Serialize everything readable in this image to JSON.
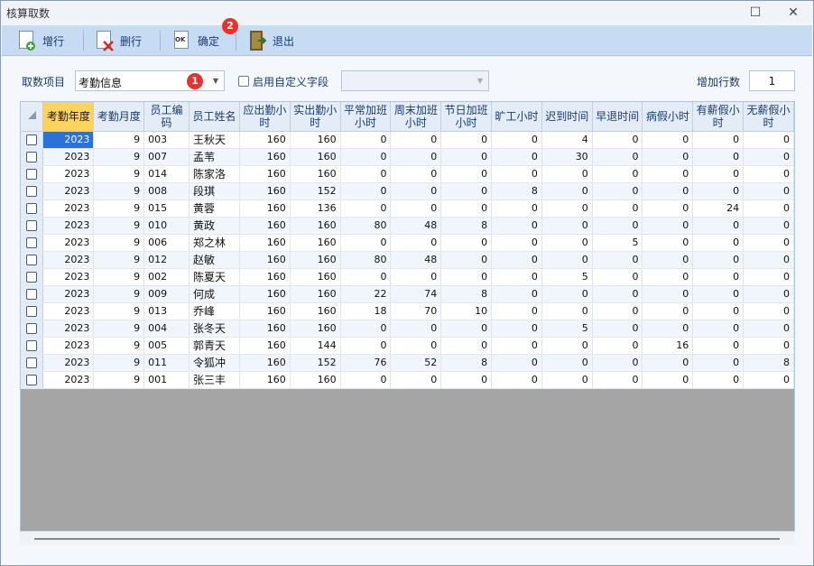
{
  "window": {
    "title": "核算取数",
    "minimize_glyph": "─",
    "maximize_glyph": "☐",
    "close_glyph": "✕"
  },
  "toolbar": {
    "add_row": "增行",
    "delete_row": "删行",
    "confirm": "确定",
    "exit": "退出",
    "ok_icon_text": "OK"
  },
  "badges": {
    "one": "1",
    "two": "2"
  },
  "filters": {
    "fetch_item_label": "取数项目",
    "fetch_item_value": "考勤信息",
    "custom_field_label": "启用自定义字段",
    "custom_field_value": "",
    "add_rows_label": "增加行数",
    "add_rows_value": "1"
  },
  "grid": {
    "columns": [
      "考勤年度",
      "考勤月度",
      "员工编码",
      "员工姓名",
      "应出勤小时",
      "实出勤小时",
      "平常加班小时",
      "周末加班小时",
      "节日加班小时",
      "旷工小时",
      "迟到时间",
      "早退时间",
      "病假小时",
      "有薪假小时",
      "无薪假小时"
    ],
    "rows": [
      [
        "2023",
        "9",
        "003",
        "王秋天",
        "160",
        "160",
        "0",
        "0",
        "0",
        "0",
        "4",
        "0",
        "0",
        "0",
        "0"
      ],
      [
        "2023",
        "9",
        "007",
        "孟苇",
        "160",
        "160",
        "0",
        "0",
        "0",
        "0",
        "30",
        "0",
        "0",
        "0",
        "0"
      ],
      [
        "2023",
        "9",
        "014",
        "陈家洛",
        "160",
        "160",
        "0",
        "0",
        "0",
        "0",
        "0",
        "0",
        "0",
        "0",
        "0"
      ],
      [
        "2023",
        "9",
        "008",
        "段琪",
        "160",
        "152",
        "0",
        "0",
        "0",
        "8",
        "0",
        "0",
        "0",
        "0",
        "0"
      ],
      [
        "2023",
        "9",
        "015",
        "黄蓉",
        "160",
        "136",
        "0",
        "0",
        "0",
        "0",
        "0",
        "0",
        "0",
        "24",
        "0"
      ],
      [
        "2023",
        "9",
        "010",
        "黄政",
        "160",
        "160",
        "80",
        "48",
        "8",
        "0",
        "0",
        "0",
        "0",
        "0",
        "0"
      ],
      [
        "2023",
        "9",
        "006",
        "郑之林",
        "160",
        "160",
        "0",
        "0",
        "0",
        "0",
        "0",
        "5",
        "0",
        "0",
        "0"
      ],
      [
        "2023",
        "9",
        "012",
        "赵敏",
        "160",
        "160",
        "80",
        "48",
        "0",
        "0",
        "0",
        "0",
        "0",
        "0",
        "0"
      ],
      [
        "2023",
        "9",
        "002",
        "陈夏天",
        "160",
        "160",
        "0",
        "0",
        "0",
        "0",
        "5",
        "0",
        "0",
        "0",
        "0"
      ],
      [
        "2023",
        "9",
        "009",
        "何成",
        "160",
        "160",
        "22",
        "74",
        "8",
        "0",
        "0",
        "0",
        "0",
        "0",
        "0"
      ],
      [
        "2023",
        "9",
        "013",
        "乔峰",
        "160",
        "160",
        "18",
        "70",
        "10",
        "0",
        "0",
        "0",
        "0",
        "0",
        "0"
      ],
      [
        "2023",
        "9",
        "004",
        "张冬天",
        "160",
        "160",
        "0",
        "0",
        "0",
        "0",
        "5",
        "0",
        "0",
        "0",
        "0"
      ],
      [
        "2023",
        "9",
        "005",
        "郭青天",
        "160",
        "144",
        "0",
        "0",
        "0",
        "0",
        "0",
        "0",
        "16",
        "0",
        "0"
      ],
      [
        "2023",
        "9",
        "011",
        "令狐冲",
        "160",
        "152",
        "76",
        "52",
        "8",
        "0",
        "0",
        "0",
        "0",
        "0",
        "8"
      ],
      [
        "2023",
        "9",
        "001",
        "张三丰",
        "160",
        "160",
        "0",
        "0",
        "0",
        "0",
        "0",
        "0",
        "0",
        "0",
        "0"
      ]
    ]
  }
}
